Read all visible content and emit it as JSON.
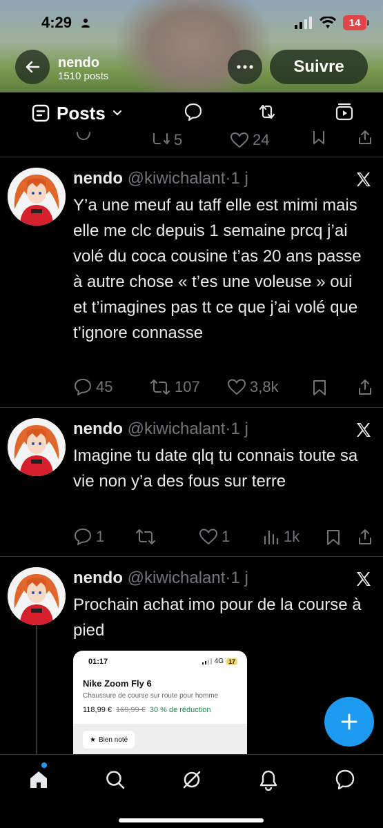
{
  "status_bar": {
    "time": "4:29",
    "battery": "14"
  },
  "header": {
    "name": "nendo",
    "posts_count": "1510 posts",
    "follow_label": "Suivre"
  },
  "tabs": {
    "active_label": "Posts"
  },
  "top_post_actions": {
    "retweets": "5",
    "likes": "24"
  },
  "posts": [
    {
      "name": "nendo",
      "handle": "@kiwichalant",
      "time": "1 j",
      "text": "Y’a une meuf au taff elle est mimi mais elle me clc depuis 1 semaine prcq j’ai volé du coca cousine t’as 20 ans passe à autre chose « t’es une voleuse » oui et t’imagines pas tt ce que j’ai volé que t’ignore connasse",
      "replies": "45",
      "retweets": "107",
      "likes": "3,8k"
    },
    {
      "name": "nendo",
      "handle": "@kiwichalant",
      "time": "1 j",
      "text": "Imagine tu date qlq tu connais toute sa vie non y’a des fous sur terre",
      "replies": "1",
      "retweets": "",
      "likes": "1",
      "views": "1k"
    },
    {
      "name": "nendo",
      "handle": "@kiwichalant",
      "time": "1 j",
      "text": "Prochain achat imo pour de la course à pied",
      "embed": {
        "time": "01:17",
        "network": "4G",
        "battery": "17",
        "product": "Nike Zoom Fly 6",
        "description": "Chaussure de course sur route pour homme",
        "price": "118,99 €",
        "old_price": "169,99 €",
        "discount": "30 % de réduction",
        "badge": "Bien noté"
      }
    }
  ],
  "colors": {
    "accent": "#1d9bf0",
    "muted": "#71767b",
    "divider": "#2f3336"
  }
}
